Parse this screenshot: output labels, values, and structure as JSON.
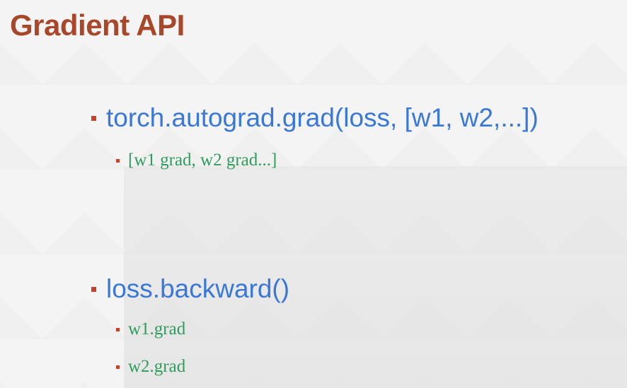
{
  "slide": {
    "title": "Gradient API",
    "bullets": [
      {
        "text": "torch.autograd.grad(loss, [w1, w2,...])",
        "sub": [
          "[w1 grad, w2 grad...]"
        ]
      },
      {
        "text": "loss.backward()",
        "sub": [
          "w1.grad",
          "w2.grad"
        ]
      }
    ]
  },
  "colors": {
    "title": "#a8472a",
    "bullet_text": "#3a78d8",
    "sub_text": "#2e9c5c",
    "bullet_marker": "#c4432a"
  }
}
